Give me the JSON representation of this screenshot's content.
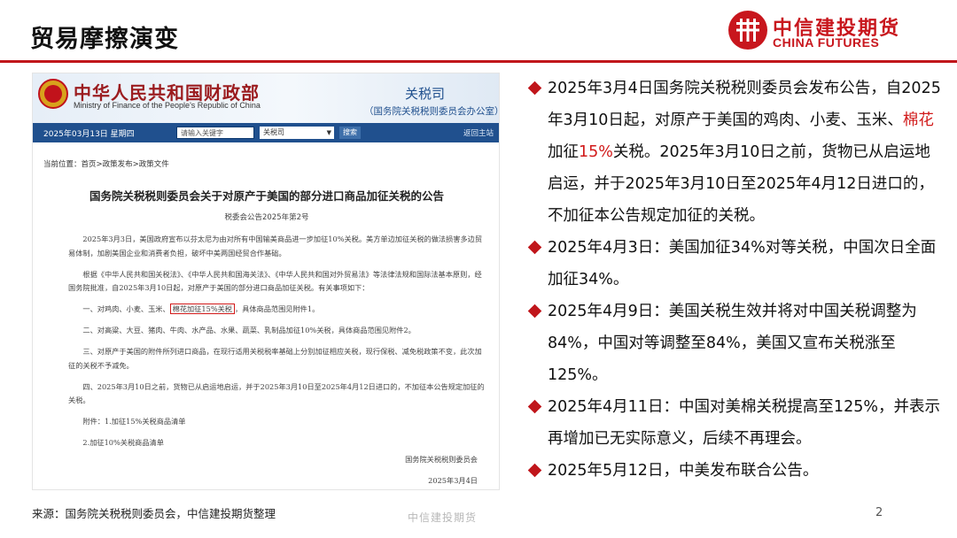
{
  "slide": {
    "title": "贸易摩擦演变",
    "logo_cn": "中信建投期货",
    "logo_en": "CHINA FUTURES",
    "accent_color": "#c0161b"
  },
  "document": {
    "ministry_cn": "中华人民共和国财政部",
    "ministry_en": "Ministry of Finance of the People's Republic of China",
    "dept_name": "关税司",
    "dept_sub": "（国务院关税税则委员会办公室）",
    "nav": {
      "date": "2025年03月13日  星期四",
      "search_placeholder": "请输入关键字",
      "select_value": "关税司",
      "search_button": "搜索",
      "home_link": "返回主站"
    },
    "breadcrumb": "当前位置：首页>政策发布>政策文件",
    "title": "国务院关税税则委员会关于对原产于美国的部分进口商品加征关税的公告",
    "number": "税委会公告2025年第2号",
    "para1": "2025年3月3日，美国政府宣布以芬太尼为由对所有中国输美商品进一步加征10%关税。美方单边加征关税的做法损害多边贸易体制，加剧美国企业和消费者负担，破坏中美两国经贸合作基础。",
    "para2": "根据《中华人民共和国关税法》、《中华人民共和国海关法》、《中华人民共和国对外贸易法》等法律法规和国际法基本原则，经国务院批准，自2025年3月10日起，对原产于美国的部分进口商品加征关税。有关事项如下：",
    "item1_prefix": "一、对鸡肉、小麦、玉米、",
    "item1_highlight": "棉花加征15%关税",
    "item1_suffix": "，具体商品范围见附件1。",
    "item2": "二、对高粱、大豆、猪肉、牛肉、水产品、水果、蔬菜、乳制品加征10%关税，具体商品范围见附件2。",
    "item3": "三、对原产于美国的附件所列进口商品，在现行适用关税税率基础上分别加征相应关税，现行保税、减免税政策不变，此次加征的关税不予减免。",
    "item4": "四、2025年3月10日之前，货物已从启运地启运，并于2025年3月10日至2025年4月12日进口的，不加征本公告规定加征的关税。",
    "attach1": "附件：1.加征15%关税商品清单",
    "attach2": "2.加征10%关税商品清单",
    "signatory": "国务院关税税则委员会",
    "date": "2025年3月4日"
  },
  "bullets": {
    "b1_part1": "2025年3月4日国务院关税税则委员会发布公告，自2025年3月10日起，对原产于美国的鸡肉、小麦、玉米、",
    "b1_red": "棉花",
    "b1_part2": "加征",
    "b1_red2": "15%",
    "b1_part3": "关税。2025年3月10日之前，货物已从启运地启运，并于2025年3月10日至2025年4月12日进口的，不加征本公告规定加征的关税。",
    "b2": "2025年4月3日：美国加征34%对等关税，中国次日全面加征34%。",
    "b3": "2025年4月9日：美国关税生效并将对中国关税调整为84%，中国对等调整至84%，美国又宣布关税涨至125%。",
    "b4": "2025年4月11日：中国对美棉关税提高至125%，并表示再增加已无实际意义，后续不再理会。",
    "b5": "2025年5月12日，中美发布联合公告。"
  },
  "footer": {
    "source": "来源：国务院关税税则委员会，中信建投期货整理",
    "watermark": "中信建投期货",
    "page": "2"
  }
}
